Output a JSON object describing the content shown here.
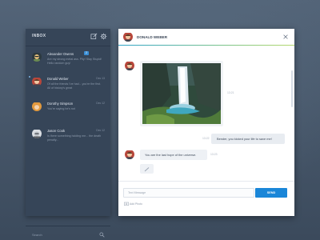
{
  "inbox": {
    "title": "INBOX",
    "threads": [
      {
        "name": "Alexander Owens",
        "badge": "2",
        "preview": "Are my strong metal ass. Pity! Stay Stupid! Hello random guy!",
        "date": ""
      },
      {
        "name": "Donald Weber",
        "preview": "Of all the friends I've had... you're the first. All of history's great",
        "date": "Dec 13"
      },
      {
        "name": "Dorothy Simpson",
        "preview": "You're saying he's not",
        "date": "Dec 12"
      },
      {
        "name": "Jason Cook",
        "preview": "Is there something holding me... the death penalty...",
        "date": "Dec 12"
      }
    ],
    "search_label": "Search"
  },
  "chat": {
    "contact_name": "DONALD WEBER",
    "messages": {
      "photo_time": "13:21",
      "outgoing_text": "Bender, you kicked your life to save me!",
      "outgoing_time": "13:22",
      "incoming_text": "You are the last hope of the universe.",
      "incoming_time": "13:23"
    },
    "composer": {
      "placeholder": "Text Message",
      "send_label": "SEND",
      "add_photo_label": "Add Photo"
    }
  },
  "colors": {
    "accent": "#1a86d8",
    "sidebar": "#364558",
    "badge": "#3b8fd6"
  }
}
